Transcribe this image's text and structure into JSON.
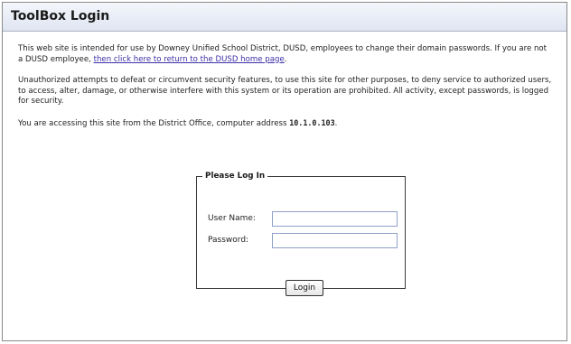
{
  "header": {
    "title": "ToolBox Login"
  },
  "intro": {
    "text_before_link": "This web site is intended for use by Downey Unified School District, DUSD, employees to change their domain passwords.  If you are not a DUSD employee, ",
    "link_text": "then click here to return to the DUSD home page",
    "text_after_link": "."
  },
  "warning": {
    "text": "Unauthorized attempts to defeat or circumvent security features, to use this site for other purposes, to deny service to authorized users, to access, alter, damage, or otherwise interfere with this system or its operation are prohibited.  All activity, except passwords, is logged for security."
  },
  "access": {
    "text": "You are accessing this site from the District Office, computer address ",
    "address": "10.1.0.103",
    "suffix": "."
  },
  "login": {
    "legend": "Please Log In",
    "username_label": "User Name:",
    "username_value": "",
    "password_label": "Password:",
    "password_value": "",
    "button_label": "Login"
  }
}
